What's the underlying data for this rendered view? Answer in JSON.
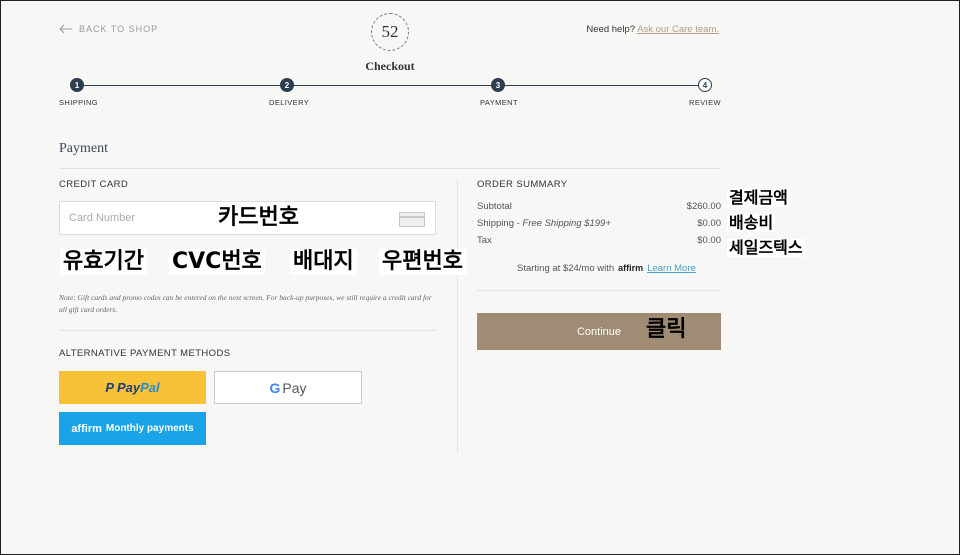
{
  "header": {
    "back_label": "BACK TO SHOP",
    "logo_text": "52",
    "title": "Checkout",
    "help_prefix": "Need help?",
    "help_link": "Ask our Care team."
  },
  "steps": [
    {
      "num": "1",
      "label": "SHIPPING",
      "state": "done"
    },
    {
      "num": "2",
      "label": "DELIVERY",
      "state": "done"
    },
    {
      "num": "3",
      "label": "PAYMENT",
      "state": "current"
    },
    {
      "num": "4",
      "label": "REVIEW",
      "state": "todo"
    }
  ],
  "payment": {
    "title": "Payment",
    "credit_card_heading": "CREDIT CARD",
    "card_number_placeholder": "Card Number",
    "card_number_value": "",
    "note": "Note: Gift cards and promo codes can be entered on the next screen. For back-up purposes, we still require a credit card for all gift card orders.",
    "alt_heading": "ALTERNATIVE PAYMENT METHODS",
    "paypal_pay": "Pay",
    "paypal_pal": "Pal",
    "gpay_g": "G",
    "gpay_pay": "Pay",
    "affirm_logo": "affirm",
    "affirm_label": "Monthly payments"
  },
  "summary": {
    "heading": "ORDER SUMMARY",
    "subtotal_label": "Subtotal",
    "subtotal_value": "$260.00",
    "shipping_label": "Shipping - ",
    "shipping_note": "Free Shipping $199+",
    "shipping_value": "$0.00",
    "tax_label": "Tax",
    "tax_value": "$0.00",
    "affirm_prefix": "Starting at $24/mo with",
    "affirm_brand": "affirm",
    "affirm_link": "Learn More",
    "continue_label": "Continue"
  },
  "annotations": {
    "card_number": "카드번호",
    "expiry": "유효기간",
    "cvc": "CVC번호",
    "billing": "배대지",
    "zip": "우편번호",
    "total": "결제금액",
    "shipping_fee": "배송비",
    "sales_tax": "세일즈텍스",
    "click": "클릭"
  },
  "colors": {
    "accent_brown": "#a08c74",
    "step_navy": "#2c3e50",
    "paypal_yellow": "#f7c237",
    "affirm_blue": "#1aa3e8"
  }
}
